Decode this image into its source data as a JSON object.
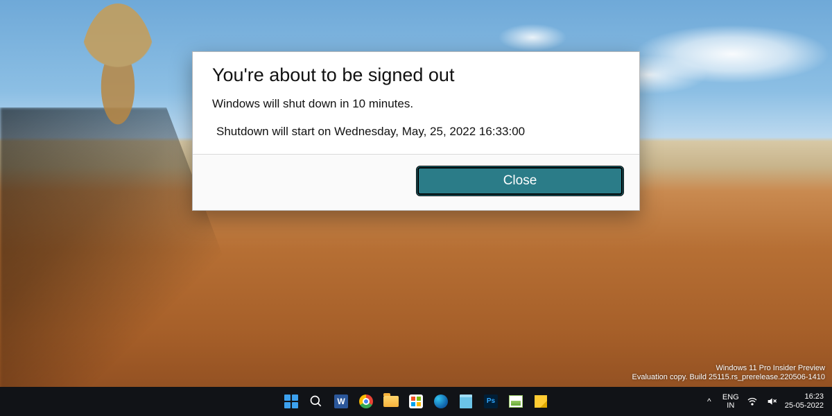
{
  "dialog": {
    "title": "You're about to be signed out",
    "message1": "Windows will shut down in 10 minutes.",
    "message2": "Shutdown will start on Wednesday, May, 25, 2022 16:33:00",
    "close_label": "Close"
  },
  "watermark": {
    "line1": "Windows 11 Pro Insider Preview",
    "line2": "Evaluation copy. Build 25115.rs_prerelease.220506-1410"
  },
  "taskbar": {
    "icons": [
      {
        "name": "start-icon"
      },
      {
        "name": "search-icon"
      },
      {
        "name": "word-icon",
        "glyph": "W"
      },
      {
        "name": "chrome-icon"
      },
      {
        "name": "file-explorer-icon"
      },
      {
        "name": "microsoft-store-icon"
      },
      {
        "name": "edge-icon"
      },
      {
        "name": "notepad-icon"
      },
      {
        "name": "photoshop-icon",
        "glyph": "Ps"
      },
      {
        "name": "photo-viewer-icon"
      },
      {
        "name": "sticky-notes-icon"
      }
    ],
    "tray": {
      "overflow_glyph": "^",
      "lang_top": "ENG",
      "lang_bottom": "IN",
      "wifi_name": "wifi-icon",
      "volume_name": "volume-muted-icon"
    },
    "clock": {
      "time": "16:23",
      "date": "25-05-2022"
    }
  }
}
